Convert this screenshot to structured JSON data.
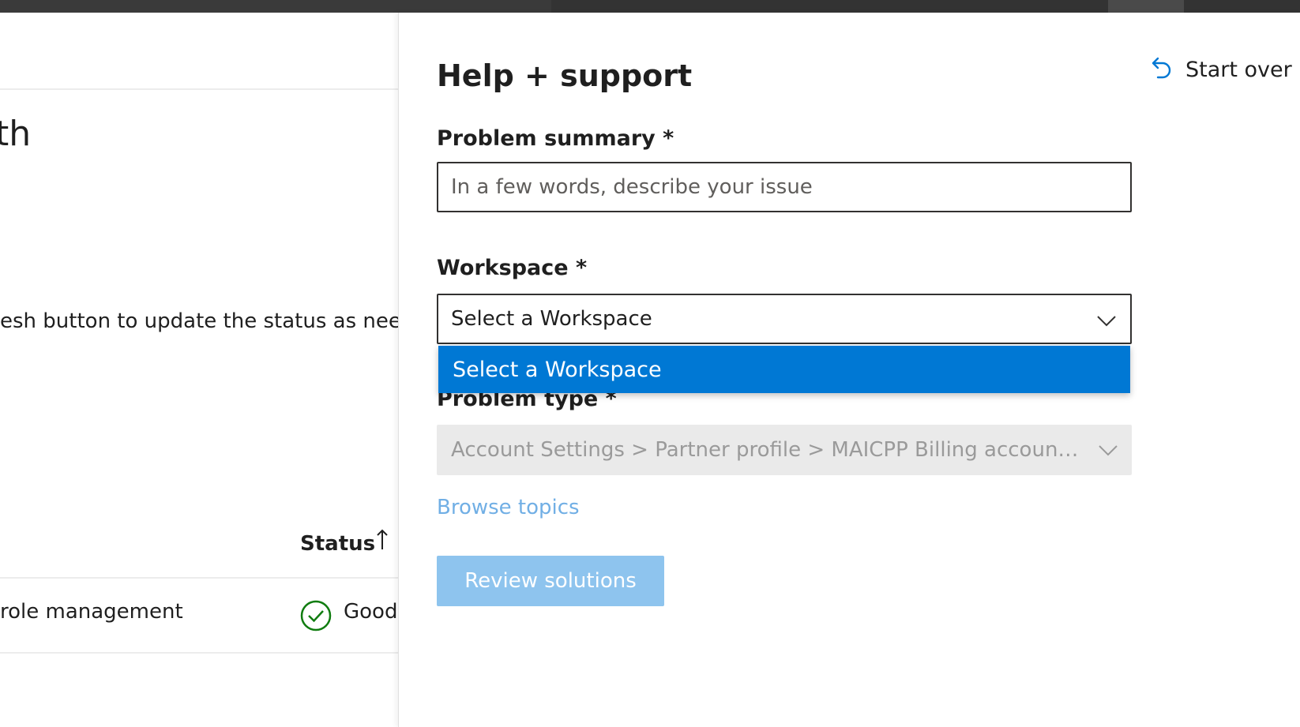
{
  "background_page": {
    "heading_fragment": "th",
    "description_fragment": "esh button to update the status as neede",
    "table": {
      "status_header": "Status",
      "row": {
        "name_fragment": "role management",
        "status": "Good"
      }
    }
  },
  "panel": {
    "title": "Help + support",
    "start_over_label": "Start over",
    "problem_summary": {
      "label": "Problem summary *",
      "value": "",
      "placeholder": "In a few words, describe your issue"
    },
    "workspace": {
      "label": "Workspace *",
      "selected": "Select a Workspace",
      "options": [
        "Select a Workspace"
      ],
      "expanded": true
    },
    "problem_type": {
      "label": "Problem type *",
      "value": "Account Settings > Partner profile > MAICPP Billing account/B...",
      "disabled": true
    },
    "browse_topics_label": "Browse topics",
    "review_button_label": "Review solutions"
  },
  "colors": {
    "accent": "#0078d4",
    "link_disabled": "#71afe5",
    "button_disabled": "#8ec4ee",
    "success": "#107c10",
    "top_bar": "#333333"
  },
  "icons": {
    "start_over": "undo-arrow-icon",
    "dropdown": "chevron-down-icon",
    "sort": "arrow-up-icon",
    "status_good": "checkmark-circle-icon"
  }
}
